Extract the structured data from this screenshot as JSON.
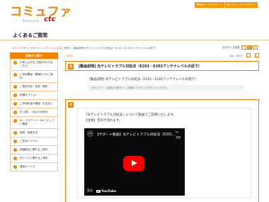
{
  "header": {
    "logo_text": "コミュファ",
    "logo_sub": "Powered by",
    "logo_brand": "ctc",
    "buttons": [
      "Webメールログイン",
      "Myコミュファログイン"
    ]
  },
  "page": {
    "title": "よくあるご質問"
  },
  "breadcrumb": "コミュファ光 ＞ サポートトップ ＞ よくあるご質問 ＞ [動画説明] 光テレビトラブル対処法（E201・E202アンテナレベルの低下）",
  "font_size": {
    "label": "文字サイズ変更",
    "options": [
      "小",
      "中",
      "大"
    ],
    "selected": "中"
  },
  "sidebar": {
    "heading": "目的から探す",
    "items": [
      "お申し込みをご検討中の方はこちら",
      "ご利用開始・開通までのご案内",
      "ご契約内容・変更・解約",
      "各種オプション",
      "ご利用料金の確認・お支払い",
      "引っ越し・休止の手続き",
      "ID・パスワード・Myコミュファ関連",
      "接続・回線方法",
      "ご利用トラブル",
      "各種設定に関するご案内",
      "光テレビに関するご案内",
      "通信サービス"
    ]
  },
  "main": {
    "back_label": "戻る",
    "question_no": "No：2819",
    "q_badge": "Q",
    "q_title": "[動画説明] 光テレビトラブル対処法（E201・E202アンテナレベルの低下）",
    "q_sub": "[動画説明] 光テレビトラブル対処法（E201・E202アンテナレベルの低下）",
    "category": "カテゴリー： 目的から探す ＞ ご利用トラブル ＞ 光テレビトラブル",
    "a_badge": "A",
    "a_line1": "「光テレビトラブル対処法」について動画でご説明いたします。",
    "a_line2": "【注意】音声が流れます。",
    "video": {
      "title": "【サポート動画】光テレビトラブル対処法（E201…",
      "share_label": "共有",
      "watch_label": "見る",
      "yt_label": "YouTube",
      "channel": "ctc"
    }
  }
}
